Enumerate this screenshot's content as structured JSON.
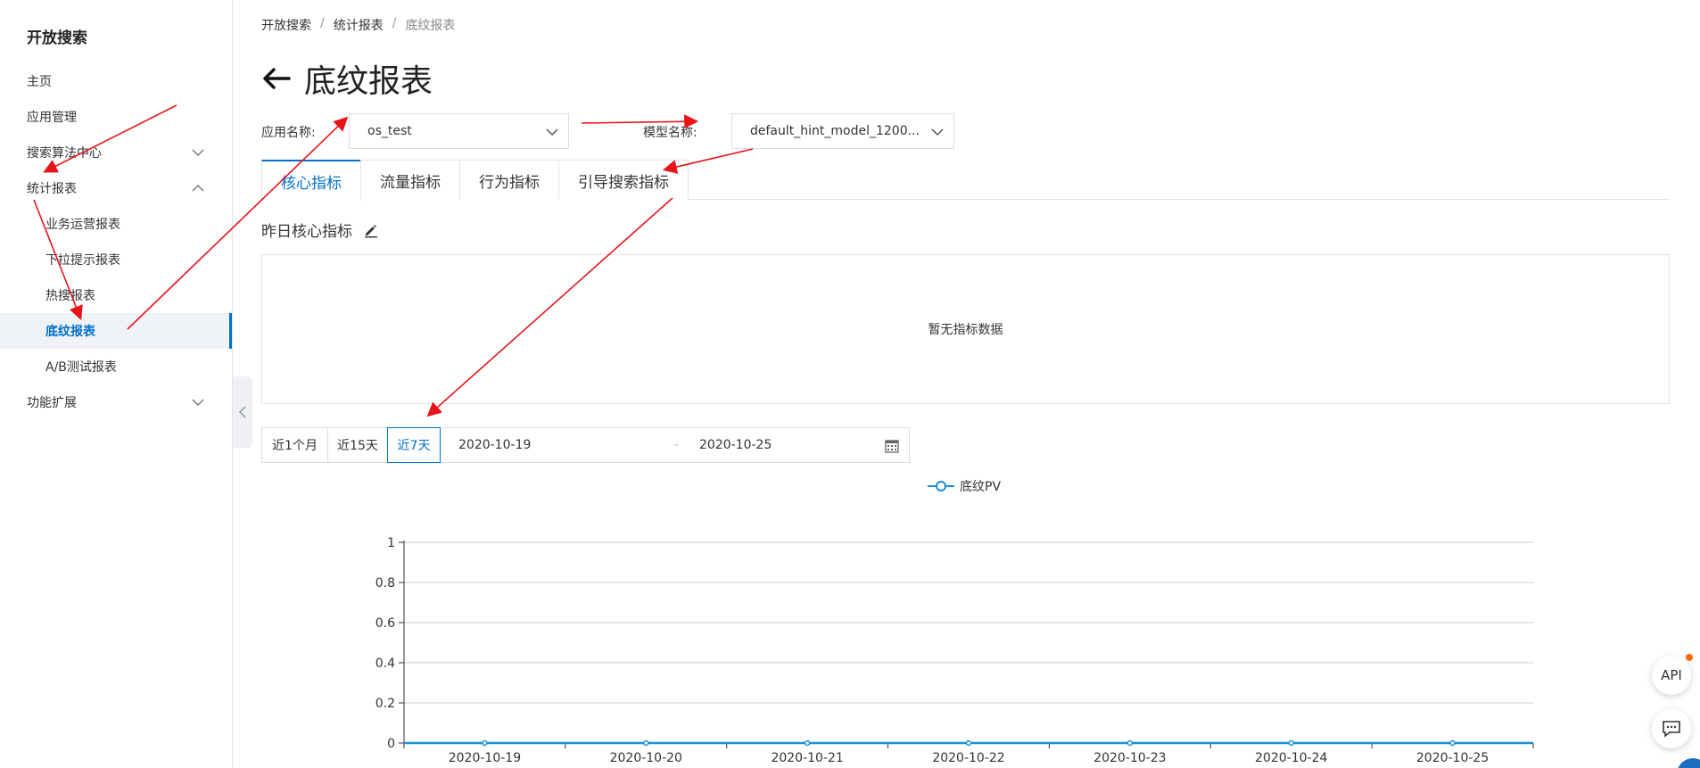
{
  "sidebar": {
    "title": "开放搜索",
    "items": [
      {
        "label": "主页",
        "sub": false,
        "chevron": null
      },
      {
        "label": "应用管理",
        "sub": false,
        "chevron": null
      },
      {
        "label": "搜索算法中心",
        "sub": false,
        "chevron": "down"
      },
      {
        "label": "统计报表",
        "sub": false,
        "chevron": "up"
      },
      {
        "label": "业务运营报表",
        "sub": true,
        "chevron": null
      },
      {
        "label": "下拉提示报表",
        "sub": true,
        "chevron": null
      },
      {
        "label": "热搜报表",
        "sub": true,
        "chevron": null
      },
      {
        "label": "底纹报表",
        "sub": true,
        "chevron": null,
        "active": true
      },
      {
        "label": "A/B测试报表",
        "sub": true,
        "chevron": null
      },
      {
        "label": "功能扩展",
        "sub": false,
        "chevron": "down"
      }
    ]
  },
  "breadcrumb": {
    "items": [
      "开放搜索",
      "统计报表",
      "底纹报表"
    ],
    "separator": "/"
  },
  "page": {
    "title": "底纹报表"
  },
  "filters": {
    "app_label": "应用名称:",
    "app_value": "os_test",
    "model_label": "模型名称:",
    "model_value": "default_hint_model_1200..."
  },
  "tabs": [
    {
      "label": "核心指标",
      "active": true
    },
    {
      "label": "流量指标",
      "active": false
    },
    {
      "label": "行为指标",
      "active": false
    },
    {
      "label": "引导搜索指标",
      "active": false
    }
  ],
  "section": {
    "title": "昨日核心指标",
    "empty_text": "暂无指标数据"
  },
  "range": {
    "buttons": [
      {
        "label": "近1个月",
        "active": false
      },
      {
        "label": "近15天",
        "active": false
      },
      {
        "label": "近7天",
        "active": true
      }
    ],
    "start": "2020-10-19",
    "separator": "-",
    "end": "2020-10-25"
  },
  "chart_data": {
    "type": "line",
    "x": [
      "2020-10-19",
      "2020-10-20",
      "2020-10-21",
      "2020-10-22",
      "2020-10-23",
      "2020-10-24",
      "2020-10-25"
    ],
    "series": [
      {
        "name": "底纹PV",
        "values": [
          0,
          0,
          0,
          0,
          0,
          0,
          0
        ]
      }
    ],
    "yticks": [
      "0",
      "0.2",
      "0.4",
      "0.6",
      "0.8",
      "1"
    ],
    "ylim": [
      0,
      1
    ],
    "grid": true,
    "legend": "top-center",
    "color": "#1890d5"
  },
  "fabs": {
    "api_label": "API"
  },
  "colors": {
    "accent": "#0070cc",
    "annotation": "#e8141a"
  }
}
